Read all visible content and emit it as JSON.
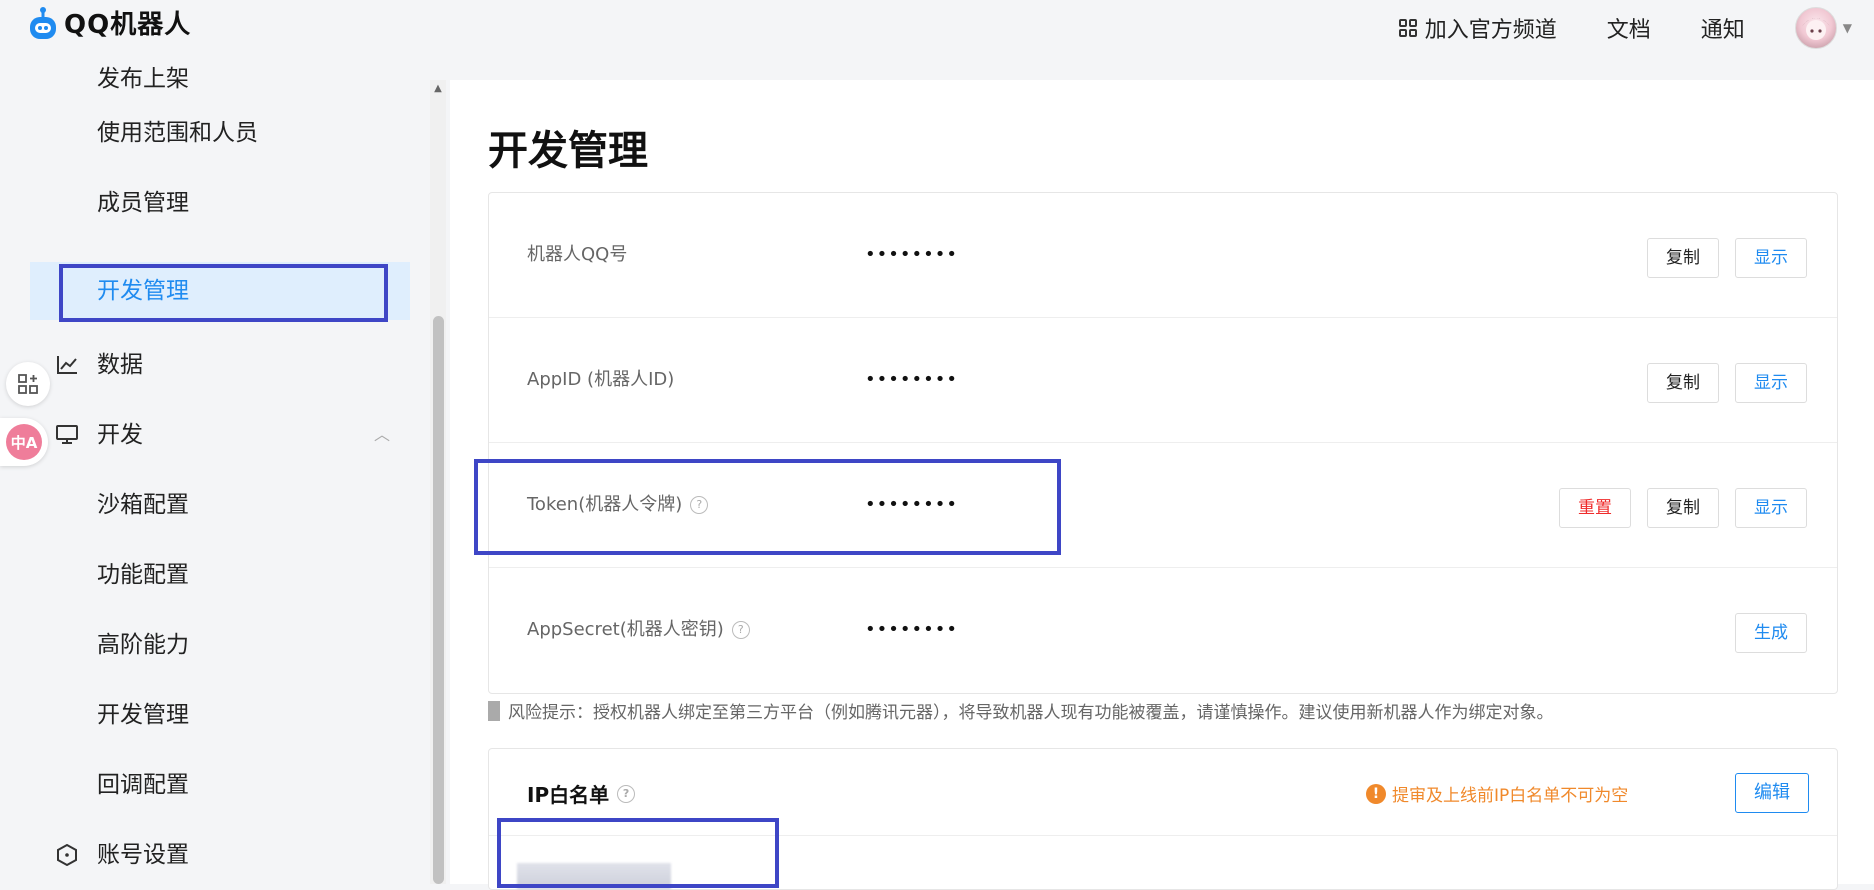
{
  "header": {
    "logo_text": "QQ机器人",
    "nav": [
      {
        "label": "加入官方频道",
        "icon": "grid-icon"
      },
      {
        "label": "文档"
      },
      {
        "label": "通知"
      }
    ]
  },
  "sidebar": {
    "items": [
      {
        "label": "发布上架"
      },
      {
        "label": "使用范围和人员"
      },
      {
        "label": "成员管理"
      },
      {
        "label": "开发管理",
        "active": true
      },
      {
        "label": "数据",
        "icon": "line-chart-icon"
      },
      {
        "label": "开发",
        "icon": "monitor-icon",
        "expanded": true
      },
      {
        "label": "沙箱配置"
      },
      {
        "label": "功能配置"
      },
      {
        "label": "高阶能力"
      },
      {
        "label": "开发管理"
      },
      {
        "label": "回调配置"
      },
      {
        "label": "账号设置",
        "icon": "hexagon-icon"
      }
    ],
    "float_translate_label": "中A"
  },
  "main": {
    "title": "开发管理",
    "credentials": [
      {
        "key": "机器人QQ号",
        "value": "••••••••",
        "actions": [
          "复制",
          "显示"
        ]
      },
      {
        "key": "AppID (机器人ID)",
        "value": "••••••••",
        "actions": [
          "复制",
          "显示"
        ]
      },
      {
        "key": "Token(机器人令牌)",
        "value": "••••••••",
        "help": true,
        "actions": [
          "重置",
          "复制",
          "显示"
        ]
      },
      {
        "key": "AppSecret(机器人密钥)",
        "value": "••••••••",
        "help": true,
        "actions": [
          "生成"
        ]
      }
    ],
    "risk_notice": "风险提示：授权机器人绑定至第三方平台（例如腾讯元器），将导致机器人现有功能被覆盖，请谨慎操作。建议使用新机器人作为绑定对象。",
    "ip_whitelist": {
      "title": "IP白名单",
      "warning": "提审及上线前IP白名单不可为空",
      "edit_label": "编辑"
    }
  },
  "colors": {
    "accent": "#1f8bf0",
    "danger": "#ef2b2b",
    "warning": "#f0892b",
    "highlight": "#3e46c6"
  }
}
